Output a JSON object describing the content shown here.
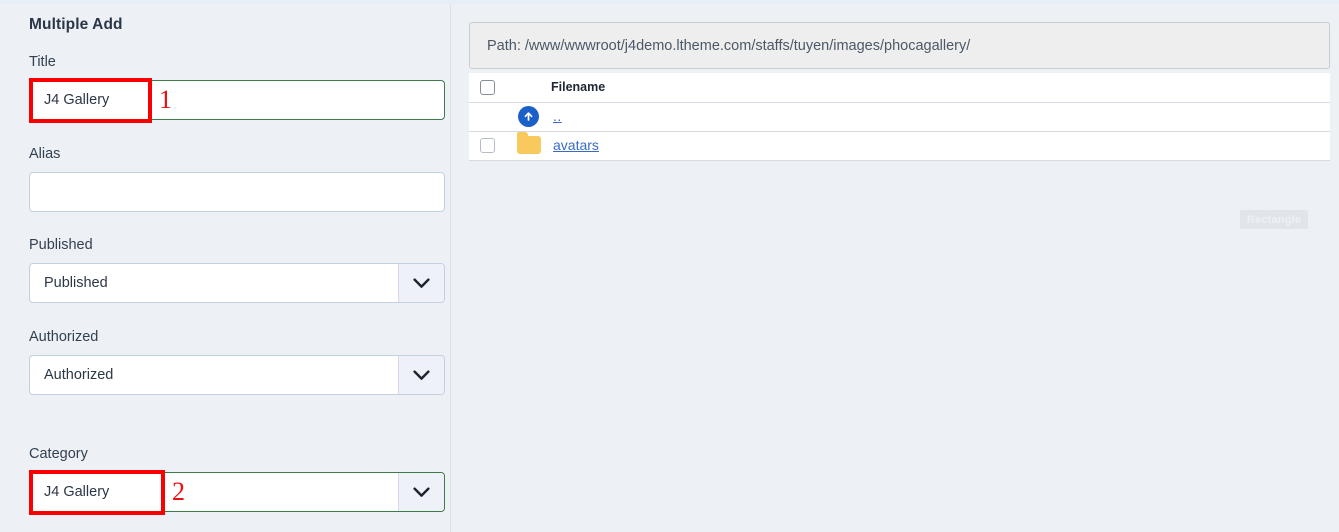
{
  "panel": {
    "title": "Multiple Add"
  },
  "form": {
    "title_label": "Title",
    "title_value": "J4 Gallery",
    "alias_label": "Alias",
    "alias_value": "",
    "alias_placeholder": "",
    "published_label": "Published",
    "published_value": "Published",
    "authorized_label": "Authorized",
    "authorized_value": "Authorized",
    "category_label": "Category",
    "category_value": "J4 Gallery"
  },
  "annotations": [
    {
      "number": "1",
      "target": "title-input"
    },
    {
      "number": "2",
      "target": "category-select"
    }
  ],
  "filebrowser": {
    "path_text": "Path: /www/wwwroot/j4demo.ltheme.com/staffs/tuyen/images/phocagallery/",
    "columns": [
      "",
      "",
      "Filename"
    ],
    "rows": [
      {
        "icon": "up-arrow-icon",
        "name": "..",
        "has_checkbox": false
      },
      {
        "icon": "folder-icon",
        "name": "avatars",
        "has_checkbox": true
      }
    ]
  },
  "overlay": {
    "rectangle_label": "Rectangle"
  },
  "colors": {
    "page_background": "#edf1f6",
    "annotation_red": "#fb0000",
    "valid_green": "#3c7a47",
    "link_blue": "#3a6bc4",
    "folder_yellow": "#f8c95c",
    "up_arrow_blue": "#1b60c9",
    "input_border": "#c3d0e0"
  }
}
